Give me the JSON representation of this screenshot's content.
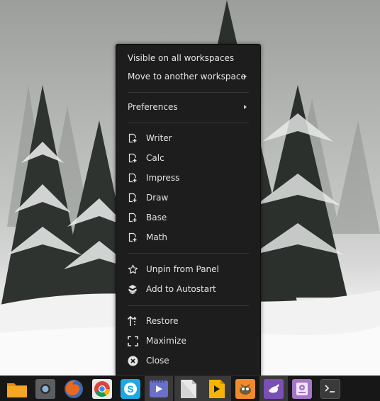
{
  "context_menu": {
    "workspace_items": [
      {
        "label": "Visible on all workspaces"
      },
      {
        "label": "Move to another workspace",
        "submenu": true
      }
    ],
    "preferences": {
      "label": "Preferences",
      "submenu": true
    },
    "launch_items": [
      {
        "label": "Writer",
        "icon": "new-document-icon"
      },
      {
        "label": "Calc",
        "icon": "new-document-icon"
      },
      {
        "label": "Impress",
        "icon": "new-document-icon"
      },
      {
        "label": "Draw",
        "icon": "new-document-icon"
      },
      {
        "label": "Base",
        "icon": "new-document-icon"
      },
      {
        "label": "Math",
        "icon": "new-document-icon"
      }
    ],
    "panel_items": [
      {
        "label": "Unpin from Panel",
        "icon": "star-outline-icon"
      },
      {
        "label": "Add to Autostart",
        "icon": "autostart-icon"
      }
    ],
    "window_items": [
      {
        "label": "Restore",
        "icon": "restore-icon"
      },
      {
        "label": "Maximize",
        "icon": "maximize-icon"
      },
      {
        "label": "Close",
        "icon": "close-circle-icon"
      }
    ]
  },
  "taskbar": {
    "apps": [
      {
        "name": "files",
        "icon": "folder-icon",
        "color": "#f2a21d"
      },
      {
        "name": "screenshot",
        "icon": "camera-icon",
        "color": "#5c5e61"
      },
      {
        "name": "firefox",
        "icon": "firefox-icon",
        "color": "#4a6fb0"
      },
      {
        "name": "chrome",
        "icon": "chrome-icon",
        "color": "#db4437"
      },
      {
        "name": "skype",
        "icon": "skype-icon",
        "color": "#1ba9e6"
      },
      {
        "name": "media-player",
        "icon": "media-player-icon",
        "color": "#6a6fc9"
      },
      {
        "name": "libreoffice",
        "icon": "libreoffice-icon",
        "color": "#e6e6e6",
        "active": true
      },
      {
        "name": "slides",
        "icon": "presentation-icon",
        "color": "#f5b400"
      },
      {
        "name": "gimp",
        "icon": "gimp-icon",
        "color": "#f08a2a"
      },
      {
        "name": "hand-tool",
        "icon": "hand-icon",
        "color": "#7b4fb6"
      },
      {
        "name": "disk-utility",
        "icon": "disk-icon",
        "color": "#a575c6"
      },
      {
        "name": "terminal",
        "icon": "terminal-icon",
        "color": "#3a3a3a"
      }
    ]
  }
}
